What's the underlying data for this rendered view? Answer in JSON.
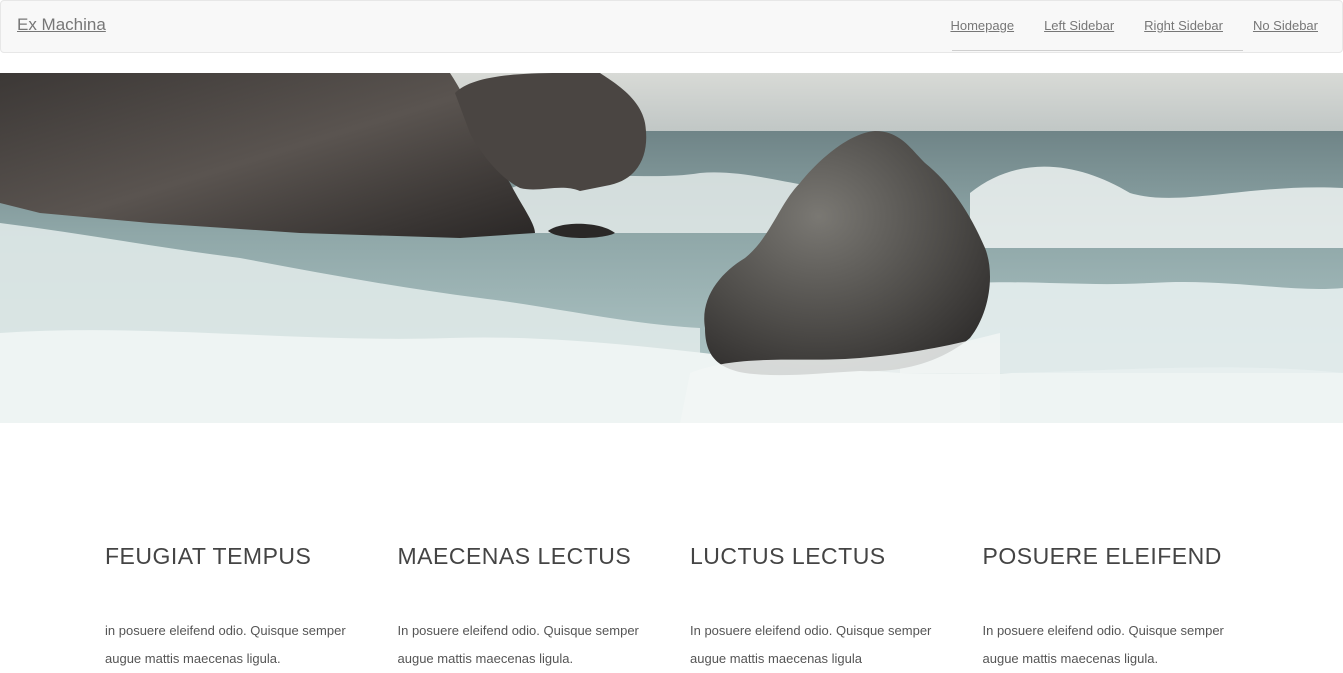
{
  "navbar": {
    "brand": "Ex Machina",
    "links": [
      {
        "label": "Homepage"
      },
      {
        "label": "Left Sidebar"
      },
      {
        "label": "Right Sidebar"
      },
      {
        "label": "No Sidebar"
      }
    ]
  },
  "hero": {
    "image": "sea-rocks-waves-photo"
  },
  "features": [
    {
      "title": "FEUGIAT TEMPUS",
      "text": "in posuere eleifend odio. Quisque semper augue mattis maecenas ligula."
    },
    {
      "title": "MAECENAS LECTUS",
      "text": "In posuere eleifend odio. Quisque semper augue mattis maecenas ligula."
    },
    {
      "title": "LUCTUS LECTUS",
      "text": "In posuere eleifend odio. Quisque semper augue mattis maecenas ligula"
    },
    {
      "title": "POSUERE ELEIFEND",
      "text": "In posuere eleifend odio. Quisque semper augue mattis maecenas ligula."
    }
  ]
}
